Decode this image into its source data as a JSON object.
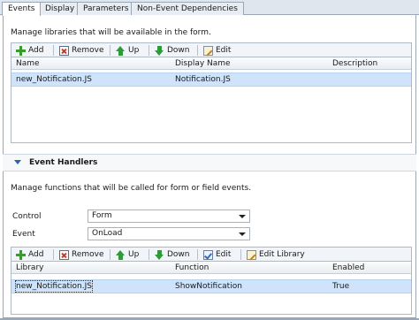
{
  "tabs": [
    {
      "label": "Events",
      "active": true
    },
    {
      "label": "Display",
      "active": false
    },
    {
      "label": "Parameters",
      "active": false
    },
    {
      "label": "Non-Event Dependencies",
      "active": false
    }
  ],
  "libraries": {
    "description": "Manage libraries that will be available in the form.",
    "toolbar": {
      "add": "Add",
      "remove": "Remove",
      "up": "Up",
      "down": "Down",
      "edit": "Edit"
    },
    "columns": [
      "Name",
      "Display Name",
      "Description"
    ],
    "rows": [
      {
        "name": "new_Notification.JS",
        "display_name": "Notification.JS",
        "description": ""
      }
    ]
  },
  "event_handlers": {
    "title": "Event Handlers",
    "description": "Manage functions that will be called for form or field events.",
    "control_label": "Control",
    "control_value": "Form",
    "event_label": "Event",
    "event_value": "OnLoad",
    "toolbar": {
      "add": "Add",
      "remove": "Remove",
      "up": "Up",
      "down": "Down",
      "edit": "Edit",
      "edit_library": "Edit Library"
    },
    "columns": [
      "Library",
      "Function",
      "Enabled"
    ],
    "rows": [
      {
        "library": "new_Notification.JS",
        "function": "ShowNotification",
        "enabled": "True"
      }
    ]
  },
  "icons": {
    "add": "add-icon",
    "remove": "remove-icon",
    "up": "up-arrow-icon",
    "down": "down-arrow-icon",
    "edit": "edit-icon",
    "edit_library": "edit-library-icon",
    "section": "chevron-down-icon",
    "dropdown": "dropdown-arrow-icon"
  },
  "colors": {
    "selected_row": "#cfe3fb",
    "tab_bar": "#dfe6ee",
    "section_caret": "#2a62b8"
  }
}
